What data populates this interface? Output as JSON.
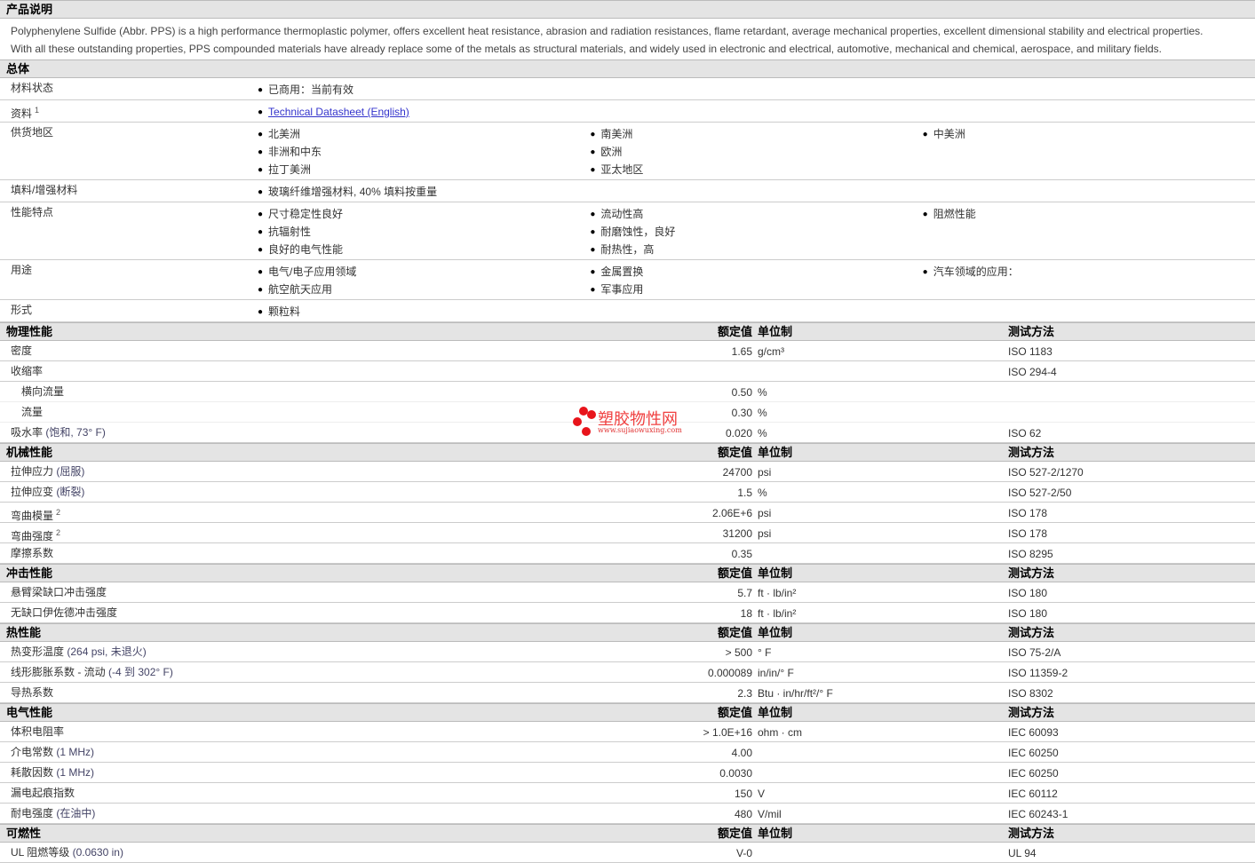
{
  "description": {
    "title": "产品说明",
    "lines": [
      "Polyphenylene Sulfide (Abbr. PPS) is a high performance thermoplastic polymer, offers excellent heat resistance, abrasion and radiation resistances, flame retardant, average mechanical properties, excellent dimensional stability and electrical properties.",
      "With all these outstanding properties, PPS compounded materials have already replace some of the metals as structural materials, and widely used in electronic and electrical, automotive, mechanical and chemical, aerospace, and military fields."
    ]
  },
  "general": {
    "title": "总体",
    "rows": [
      {
        "label": "材料状态",
        "cols": [
          [
            "已商用：当前有效"
          ]
        ]
      },
      {
        "label": "资料",
        "sup": "1",
        "link": "Technical Datasheet (English)"
      },
      {
        "label": "供货地区",
        "cols": [
          [
            "北美洲",
            "非洲和中东",
            "拉丁美洲"
          ],
          [
            "南美洲",
            "欧洲",
            "亚太地区"
          ],
          [
            "中美洲"
          ]
        ]
      },
      {
        "label": "填料/增强材料",
        "cols": [
          [
            "玻璃纤维增强材料, 40% 填料按重量"
          ]
        ]
      },
      {
        "label": "性能特点",
        "cols": [
          [
            "尺寸稳定性良好",
            "抗辐射性",
            "良好的电气性能"
          ],
          [
            "流动性高",
            "耐磨蚀性，良好",
            "耐热性，高"
          ],
          [
            "阻燃性能"
          ]
        ]
      },
      {
        "label": "用途",
        "cols": [
          [
            "电气/电子应用领域",
            "航空航天应用"
          ],
          [
            "金属置换",
            "军事应用"
          ],
          [
            "汽车领域的应用："
          ]
        ]
      },
      {
        "label": "形式",
        "cols": [
          [
            "颗粒料"
          ]
        ]
      }
    ]
  },
  "columns": {
    "value": "额定值",
    "unit": "单位制",
    "method": "测试方法"
  },
  "sections": [
    {
      "title": "物理性能",
      "rows": [
        {
          "label": "密度",
          "value": "1.65",
          "unit": "g/cm³",
          "method": "ISO 1183"
        },
        {
          "label": "收缩率",
          "value": "",
          "unit": "",
          "method": "ISO 294-4"
        },
        {
          "label": "横向流量",
          "sub": true,
          "value": "0.50",
          "unit": "%",
          "method": ""
        },
        {
          "label": "流量",
          "sub": true,
          "value": "0.30",
          "unit": "%",
          "method": ""
        },
        {
          "label": "吸水率",
          "cond": "(饱和, 73° F)",
          "value": "0.020",
          "unit": "%",
          "method": "ISO 62"
        }
      ]
    },
    {
      "title": "机械性能",
      "rows": [
        {
          "label": "拉伸应力",
          "cond": "(屈服)",
          "value": "24700",
          "unit": "psi",
          "method": "ISO 527-2/1270"
        },
        {
          "label": "拉伸应变",
          "cond": "(断裂)",
          "value": "1.5",
          "unit": "%",
          "method": "ISO 527-2/50"
        },
        {
          "label": "弯曲模量",
          "sup": "2",
          "value": "2.06E+6",
          "unit": "psi",
          "method": "ISO 178"
        },
        {
          "label": "弯曲强度",
          "sup": "2",
          "value": "31200",
          "unit": "psi",
          "method": "ISO 178"
        },
        {
          "label": "摩擦系数",
          "value": "0.35",
          "unit": "",
          "method": "ISO 8295"
        }
      ]
    },
    {
      "title": "冲击性能",
      "rows": [
        {
          "label": "悬臂梁缺口冲击强度",
          "value": "5.7",
          "unit": "ft · lb/in²",
          "method": "ISO 180"
        },
        {
          "label": "无缺口伊佐德冲击强度",
          "value": "18",
          "unit": "ft · lb/in²",
          "method": "ISO 180"
        }
      ]
    },
    {
      "title": "热性能",
      "rows": [
        {
          "label": "热变形温度",
          "cond": "(264 psi, 未退火)",
          "value": "> 500",
          "unit": "° F",
          "method": "ISO 75-2/A"
        },
        {
          "label": "线形膨胀系数 - 流动",
          "cond": "(-4 到 302° F)",
          "value": "0.000089",
          "unit": "in/in/° F",
          "method": "ISO 11359-2"
        },
        {
          "label": "导热系数",
          "value": "2.3",
          "unit": "Btu · in/hr/ft²/° F",
          "method": "ISO 8302"
        }
      ]
    },
    {
      "title": "电气性能",
      "rows": [
        {
          "label": "体积电阻率",
          "value": "> 1.0E+16",
          "unit": "ohm · cm",
          "method": "IEC 60093"
        },
        {
          "label": "介电常数",
          "cond": "(1 MHz)",
          "value": "4.00",
          "unit": "",
          "method": "IEC 60250"
        },
        {
          "label": "耗散因数",
          "cond": "(1 MHz)",
          "value": "0.0030",
          "unit": "",
          "method": "IEC 60250"
        },
        {
          "label": "漏电起痕指数",
          "value": "150",
          "unit": "V",
          "method": "IEC 60112"
        },
        {
          "label": "耐电强度",
          "cond": "(在油中)",
          "value": "480",
          "unit": "V/mil",
          "method": "IEC 60243-1"
        }
      ]
    },
    {
      "title": "可燃性",
      "rows": [
        {
          "label": "UL 阻燃等级",
          "cond": "(0.0630 in)",
          "value": "V-0",
          "unit": "",
          "method": "UL 94"
        }
      ]
    }
  ],
  "watermark": {
    "name": "塑胶物性网",
    "url": "www.sujiaowuxing.com"
  }
}
